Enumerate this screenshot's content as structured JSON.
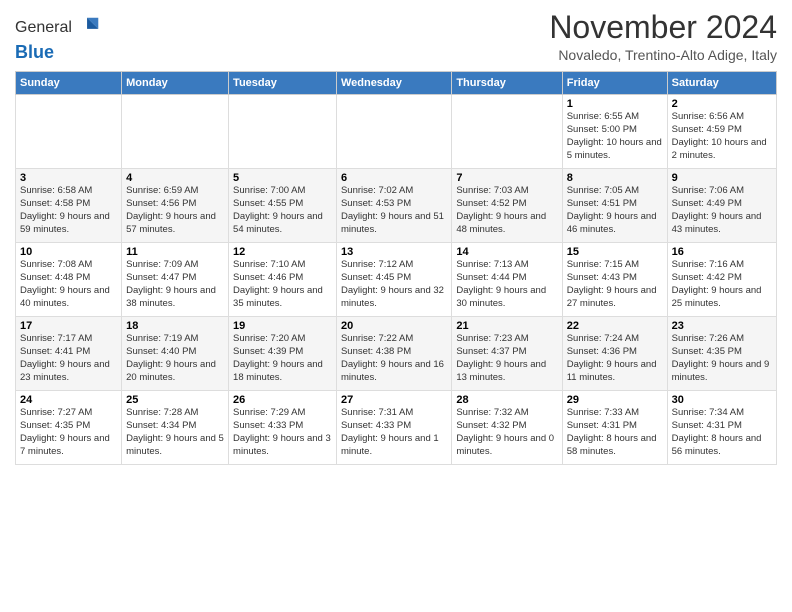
{
  "header": {
    "logo_line1": "General",
    "logo_line2": "Blue",
    "month_title": "November 2024",
    "subtitle": "Novaledo, Trentino-Alto Adige, Italy"
  },
  "days_of_week": [
    "Sunday",
    "Monday",
    "Tuesday",
    "Wednesday",
    "Thursday",
    "Friday",
    "Saturday"
  ],
  "weeks": [
    [
      {
        "day": "",
        "info": ""
      },
      {
        "day": "",
        "info": ""
      },
      {
        "day": "",
        "info": ""
      },
      {
        "day": "",
        "info": ""
      },
      {
        "day": "",
        "info": ""
      },
      {
        "day": "1",
        "info": "Sunrise: 6:55 AM\nSunset: 5:00 PM\nDaylight: 10 hours and 5 minutes."
      },
      {
        "day": "2",
        "info": "Sunrise: 6:56 AM\nSunset: 4:59 PM\nDaylight: 10 hours and 2 minutes."
      }
    ],
    [
      {
        "day": "3",
        "info": "Sunrise: 6:58 AM\nSunset: 4:58 PM\nDaylight: 9 hours and 59 minutes."
      },
      {
        "day": "4",
        "info": "Sunrise: 6:59 AM\nSunset: 4:56 PM\nDaylight: 9 hours and 57 minutes."
      },
      {
        "day": "5",
        "info": "Sunrise: 7:00 AM\nSunset: 4:55 PM\nDaylight: 9 hours and 54 minutes."
      },
      {
        "day": "6",
        "info": "Sunrise: 7:02 AM\nSunset: 4:53 PM\nDaylight: 9 hours and 51 minutes."
      },
      {
        "day": "7",
        "info": "Sunrise: 7:03 AM\nSunset: 4:52 PM\nDaylight: 9 hours and 48 minutes."
      },
      {
        "day": "8",
        "info": "Sunrise: 7:05 AM\nSunset: 4:51 PM\nDaylight: 9 hours and 46 minutes."
      },
      {
        "day": "9",
        "info": "Sunrise: 7:06 AM\nSunset: 4:49 PM\nDaylight: 9 hours and 43 minutes."
      }
    ],
    [
      {
        "day": "10",
        "info": "Sunrise: 7:08 AM\nSunset: 4:48 PM\nDaylight: 9 hours and 40 minutes."
      },
      {
        "day": "11",
        "info": "Sunrise: 7:09 AM\nSunset: 4:47 PM\nDaylight: 9 hours and 38 minutes."
      },
      {
        "day": "12",
        "info": "Sunrise: 7:10 AM\nSunset: 4:46 PM\nDaylight: 9 hours and 35 minutes."
      },
      {
        "day": "13",
        "info": "Sunrise: 7:12 AM\nSunset: 4:45 PM\nDaylight: 9 hours and 32 minutes."
      },
      {
        "day": "14",
        "info": "Sunrise: 7:13 AM\nSunset: 4:44 PM\nDaylight: 9 hours and 30 minutes."
      },
      {
        "day": "15",
        "info": "Sunrise: 7:15 AM\nSunset: 4:43 PM\nDaylight: 9 hours and 27 minutes."
      },
      {
        "day": "16",
        "info": "Sunrise: 7:16 AM\nSunset: 4:42 PM\nDaylight: 9 hours and 25 minutes."
      }
    ],
    [
      {
        "day": "17",
        "info": "Sunrise: 7:17 AM\nSunset: 4:41 PM\nDaylight: 9 hours and 23 minutes."
      },
      {
        "day": "18",
        "info": "Sunrise: 7:19 AM\nSunset: 4:40 PM\nDaylight: 9 hours and 20 minutes."
      },
      {
        "day": "19",
        "info": "Sunrise: 7:20 AM\nSunset: 4:39 PM\nDaylight: 9 hours and 18 minutes."
      },
      {
        "day": "20",
        "info": "Sunrise: 7:22 AM\nSunset: 4:38 PM\nDaylight: 9 hours and 16 minutes."
      },
      {
        "day": "21",
        "info": "Sunrise: 7:23 AM\nSunset: 4:37 PM\nDaylight: 9 hours and 13 minutes."
      },
      {
        "day": "22",
        "info": "Sunrise: 7:24 AM\nSunset: 4:36 PM\nDaylight: 9 hours and 11 minutes."
      },
      {
        "day": "23",
        "info": "Sunrise: 7:26 AM\nSunset: 4:35 PM\nDaylight: 9 hours and 9 minutes."
      }
    ],
    [
      {
        "day": "24",
        "info": "Sunrise: 7:27 AM\nSunset: 4:35 PM\nDaylight: 9 hours and 7 minutes."
      },
      {
        "day": "25",
        "info": "Sunrise: 7:28 AM\nSunset: 4:34 PM\nDaylight: 9 hours and 5 minutes."
      },
      {
        "day": "26",
        "info": "Sunrise: 7:29 AM\nSunset: 4:33 PM\nDaylight: 9 hours and 3 minutes."
      },
      {
        "day": "27",
        "info": "Sunrise: 7:31 AM\nSunset: 4:33 PM\nDaylight: 9 hours and 1 minute."
      },
      {
        "day": "28",
        "info": "Sunrise: 7:32 AM\nSunset: 4:32 PM\nDaylight: 9 hours and 0 minutes."
      },
      {
        "day": "29",
        "info": "Sunrise: 7:33 AM\nSunset: 4:31 PM\nDaylight: 8 hours and 58 minutes."
      },
      {
        "day": "30",
        "info": "Sunrise: 7:34 AM\nSunset: 4:31 PM\nDaylight: 8 hours and 56 minutes."
      }
    ]
  ]
}
